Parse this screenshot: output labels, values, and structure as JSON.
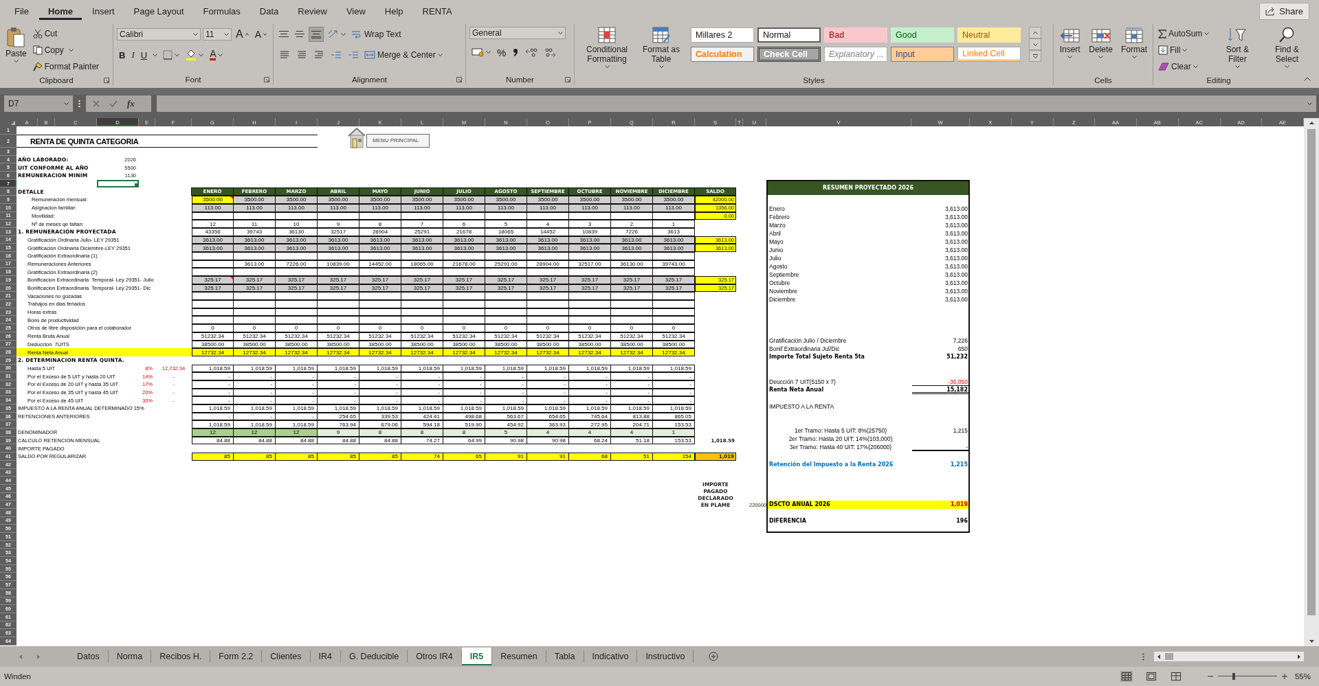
{
  "menu_tabs": [
    {
      "label": "File",
      "selected": false
    },
    {
      "label": "Home",
      "selected": true
    },
    {
      "label": "Insert",
      "selected": false
    },
    {
      "label": "Page Layout",
      "selected": false
    },
    {
      "label": "Formulas",
      "selected": false
    },
    {
      "label": "Data",
      "selected": false
    },
    {
      "label": "Review",
      "selected": false
    },
    {
      "label": "View",
      "selected": false
    },
    {
      "label": "Help",
      "selected": false
    },
    {
      "label": "RENTA",
      "selected": false
    }
  ],
  "share_button": "Share",
  "ribbon": {
    "clipboard": {
      "paste": "Paste",
      "cut": "Cut",
      "copy": "Copy",
      "format_painter": "Format Painter",
      "label": "Clipboard"
    },
    "font": {
      "name": "Calibri",
      "size": "11",
      "grow": "A",
      "shrink": "A",
      "bold": "B",
      "italic": "I",
      "underline": "U",
      "font_color": "A",
      "label": "Font"
    },
    "alignment": {
      "vertical": [
        {
          "selected": false
        },
        {
          "selected": false
        },
        {
          "selected": true
        }
      ],
      "wrap_text": "Wrap Text",
      "merge_center": "Merge & Center",
      "label": "Alignment"
    },
    "number": {
      "format": "General",
      "percent": "%",
      "label": "Number"
    },
    "styles": {
      "conditional_formatting": "Conditional Formatting",
      "format_as_table": "Format as Table",
      "label": "Styles",
      "gallery": [
        {
          "label": "Millares 2",
          "kind": "millares",
          "selected": false
        },
        {
          "label": "Normal",
          "kind": "normal",
          "selected": true
        },
        {
          "label": "Bad",
          "kind": "bad",
          "selected": false
        },
        {
          "label": "Good",
          "kind": "good",
          "selected": false
        },
        {
          "label": "Neutral",
          "kind": "neutral",
          "selected": false
        },
        {
          "label": "Calculation",
          "kind": "calculation",
          "selected": false
        },
        {
          "label": "Check Cell",
          "kind": "check",
          "selected": false
        },
        {
          "label": "Explanatory ...",
          "kind": "explanatory",
          "selected": false
        },
        {
          "label": "Input",
          "kind": "input",
          "selected": false
        },
        {
          "label": "Linked Cell",
          "kind": "linked",
          "selected": false
        }
      ]
    },
    "cells": {
      "buttons": [
        {
          "label": "Insert",
          "kind": "insert"
        },
        {
          "label": "Delete",
          "kind": "delete"
        },
        {
          "label": "Format",
          "kind": "format"
        }
      ],
      "label": "Cells"
    },
    "editing": {
      "autosum": "AutoSum",
      "fill": "Fill",
      "clear": "Clear",
      "sort_filter": "Sort & Filter",
      "find_select": "Find & Select",
      "label": "Editing"
    }
  },
  "formula_bar": {
    "name_box": "D7",
    "fx": "fx"
  },
  "sheet": {
    "column_headers": [
      {
        "label": "A",
        "selected": false
      },
      {
        "label": "B",
        "selected": false
      },
      {
        "label": "C",
        "selected": false
      },
      {
        "label": "D",
        "selected": true
      },
      {
        "label": "E",
        "selected": false
      },
      {
        "label": "F",
        "selected": false
      },
      {
        "label": "G",
        "selected": false
      },
      {
        "label": "H",
        "selected": false
      },
      {
        "label": "I",
        "selected": false
      },
      {
        "label": "J",
        "selected": false
      },
      {
        "label": "K",
        "selected": false
      },
      {
        "label": "L",
        "selected": false
      },
      {
        "label": "M",
        "selected": false
      },
      {
        "label": "N",
        "selected": false
      },
      {
        "label": "O",
        "selected": false
      },
      {
        "label": "P",
        "selected": false
      },
      {
        "label": "Q",
        "selected": false
      },
      {
        "label": "R",
        "selected": false
      },
      {
        "label": "S",
        "selected": false
      },
      {
        "label": "T",
        "selected": false
      },
      {
        "label": "U",
        "selected": false
      },
      {
        "label": "V",
        "selected": false
      },
      {
        "label": "W",
        "selected": false
      },
      {
        "label": "X",
        "selected": false
      },
      {
        "label": "Y",
        "selected": false
      },
      {
        "label": "Z",
        "selected": false
      },
      {
        "label": "AA",
        "selected": false
      },
      {
        "label": "AB",
        "selected": false
      },
      {
        "label": "AC",
        "selected": false
      },
      {
        "label": "AD",
        "selected": false
      },
      {
        "label": "AE",
        "selected": false
      }
    ],
    "row_headers": [
      {
        "label": "1",
        "selected": false
      },
      {
        "label": "2",
        "selected": false
      },
      {
        "label": "3",
        "selected": false
      },
      {
        "label": "4",
        "selected": false
      },
      {
        "label": "5",
        "selected": false
      },
      {
        "label": "6",
        "selected": false
      },
      {
        "label": "7",
        "selected": true
      },
      {
        "label": "8",
        "selected": false
      },
      {
        "label": "9",
        "selected": false
      },
      {
        "label": "10",
        "selected": false
      },
      {
        "label": "11",
        "selected": false
      },
      {
        "label": "12",
        "selected": false
      },
      {
        "label": "13",
        "selected": false
      },
      {
        "label": "14",
        "selected": false
      },
      {
        "label": "15",
        "selected": false
      },
      {
        "label": "16",
        "selected": false
      },
      {
        "label": "17",
        "selected": false
      },
      {
        "label": "18",
        "selected": false
      },
      {
        "label": "19",
        "selected": false
      },
      {
        "label": "20",
        "selected": false
      },
      {
        "label": "21",
        "selected": false
      },
      {
        "label": "22",
        "selected": false
      },
      {
        "label": "23",
        "selected": false
      },
      {
        "label": "24",
        "selected": false
      },
      {
        "label": "25",
        "selected": false
      },
      {
        "label": "26",
        "selected": false
      },
      {
        "label": "27",
        "selected": false
      },
      {
        "label": "28",
        "selected": false
      },
      {
        "label": "29",
        "selected": false
      },
      {
        "label": "30",
        "selected": false
      },
      {
        "label": "31",
        "selected": false
      },
      {
        "label": "32",
        "selected": false
      },
      {
        "label": "33",
        "selected": false
      },
      {
        "label": "34",
        "selected": false
      },
      {
        "label": "35",
        "selected": false
      },
      {
        "label": "36",
        "selected": false
      },
      {
        "label": "37",
        "selected": false
      },
      {
        "label": "38",
        "selected": false
      },
      {
        "label": "39",
        "selected": false
      },
      {
        "label": "40",
        "selected": false
      },
      {
        "label": "41",
        "selected": false
      },
      {
        "label": "42",
        "selected": false
      },
      {
        "label": "43",
        "selected": false
      },
      {
        "label": "44",
        "selected": false
      },
      {
        "label": "45",
        "selected": false
      },
      {
        "label": "46",
        "selected": false
      },
      {
        "label": "47",
        "selected": false
      },
      {
        "label": "48",
        "selected": false
      },
      {
        "label": "49",
        "selected": false
      },
      {
        "label": "50",
        "selected": false
      },
      {
        "label": "51",
        "selected": false
      },
      {
        "label": "52",
        "selected": false
      },
      {
        "label": "53",
        "selected": false
      },
      {
        "label": "54",
        "selected": false
      },
      {
        "label": "55",
        "selected": false
      },
      {
        "label": "56",
        "selected": false
      },
      {
        "label": "57",
        "selected": false
      },
      {
        "label": "58",
        "selected": false
      },
      {
        "label": "59",
        "selected": false
      },
      {
        "label": "60",
        "selected": false
      },
      {
        "label": "61",
        "selected": false
      },
      {
        "label": "62",
        "selected": false
      },
      {
        "label": "63",
        "selected": false
      },
      {
        "label": "64",
        "selected": false
      }
    ],
    "title": "RENTA DE QUINTA CATEGORIA",
    "menu_button": "MENU PRINCIPAL",
    "params": [
      {
        "label": "AÑO LABORADO:",
        "value": "2026"
      },
      {
        "label": "UIT CONFORME AL AÑO",
        "value": "5500"
      },
      {
        "label": "REMUNERACION MINIM",
        "value": "1130"
      }
    ],
    "header_row": {
      "label": "DETALLE",
      "months": [
        "ENERO",
        "FEBRERO",
        "MARZO",
        "ABRIL",
        "MAYO",
        "JUNIO",
        "JULIO",
        "AGOSTO",
        "SEPTIEMBRE",
        "OCTUBRE",
        "NOVIEMBRE",
        "DICIEMBRE"
      ],
      "total": "SALDO"
    },
    "rows": [
      {
        "label": {
          "text": "Remuneración mensual:",
          "kind": "field"
        },
        "cells": {
          "kind": "input",
          "values": [
            {
              "text": "3500.00",
              "color": "#ffff00",
              "comment": true
            },
            "3500.00",
            "3500.00",
            "3500.00",
            "3500.00",
            "3500.00",
            "3500.00",
            "3500.00",
            "3500.00",
            "3500.00",
            "3500.00",
            "3500.00"
          ]
        },
        "total": {
          "text": "42000.00",
          "kind": "saldo"
        }
      },
      {
        "label": {
          "text": "Asignacion familiar:",
          "kind": "field"
        },
        "cells": {
          "kind": "input",
          "values": [
            "113.00",
            "113.00",
            "113.00",
            "113.00",
            "113.00",
            "113.00",
            "113.00",
            "113.00",
            "113.00",
            "113.00",
            "113.00",
            "113.00"
          ]
        },
        "total": {
          "text": "1356.00",
          "kind": "saldo"
        }
      },
      {
        "label": {
          "text": "Movilidad:",
          "kind": "field"
        },
        "cells": {
          "kind": "plain"
        },
        "total": {
          "text": "0.00",
          "kind": "saldo"
        }
      },
      {
        "label": {
          "text": "Nº de meses qe faltan:",
          "kind": "field"
        },
        "cells": {
          "kind": "plain",
          "values": [
            "12",
            "11",
            "10",
            "9",
            "8",
            "7",
            "6",
            "5",
            "4",
            "3",
            "2",
            "1"
          ]
        }
      },
      {
        "label": {
          "text": "1. REMUNERACIÒN PROYECTADA",
          "kind": "heading"
        },
        "cells": {
          "kind": "plain",
          "values": [
            "43356",
            "39743",
            "36130",
            "32517",
            "28904",
            "25291",
            "21678",
            "18065",
            "14452",
            "10839",
            "7226",
            "3613"
          ]
        }
      },
      {
        "label": {
          "text": "Gratificación Ordinaria Julio- LEY 29351",
          "kind": "item"
        },
        "cells": {
          "kind": "input",
          "values": [
            "3613.00",
            "3613.00",
            "3613.00",
            "3613.00",
            "3613.00",
            "3613.00",
            "3613.00",
            "3613.00",
            "3613.00",
            "3613.00",
            "3613.00",
            "3613.00"
          ]
        },
        "total": {
          "text": "3613.00",
          "kind": "saldo"
        }
      },
      {
        "label": {
          "text": "Gratificación Ordinaria Diciembre-LEY 29351",
          "kind": "item"
        },
        "cells": {
          "kind": "input",
          "values": [
            "3613.00",
            "3613.00",
            "3613.00",
            "3613.00",
            "3613.00",
            "3613.00",
            "3613.00",
            "3613.00",
            "3613.00",
            "3613.00",
            "3613.00",
            "3613.00"
          ]
        },
        "total": {
          "text": "3613.00",
          "kind": "saldo"
        }
      },
      {
        "label": {
          "text": "Gratificación Extraordinaria (1)",
          "kind": "item"
        },
        "cells": {
          "kind": "plain"
        }
      },
      {
        "label": {
          "text": "Remuneraciones Anteriores",
          "kind": "item"
        },
        "cells": {
          "kind": "plain",
          "lead_blank": true,
          "values": [
            "3613.00",
            "7226.00",
            "10839.00",
            "14452.00",
            "18065.00",
            "21678.00",
            "25291.00",
            "28904.00",
            "32517.00",
            "36130.00",
            "39743.00"
          ]
        }
      },
      {
        "label": {
          "text": "Gratificación Extraordinaria (2)",
          "kind": "item"
        },
        "cells": {
          "kind": "plain"
        }
      },
      {
        "label": {
          "text": "Bonificacion Extraordinaria  Temporal- Ley 29351- Julio",
          "kind": "item"
        },
        "cells": {
          "kind": "input",
          "values": [
            {
              "text": "325.17",
              "comment": true
            },
            "325.17",
            "325.17",
            "325.17",
            "325.17",
            "325.17",
            "325.17",
            "325.17",
            "325.17",
            "325.17",
            "325.17",
            "325.17"
          ]
        },
        "total": {
          "text": "325.17",
          "kind": "saldo"
        }
      },
      {
        "label": {
          "text": "Bonificacion Extraordinaria  Temporal- Ley 29351- Dic",
          "kind": "item"
        },
        "cells": {
          "kind": "input",
          "values": [
            "325.17",
            "325.17",
            "325.17",
            "325.17",
            "325.17",
            "325.17",
            "325.17",
            "325.17",
            "325.17",
            "325.17",
            "325.17",
            "325.17"
          ]
        },
        "total": {
          "text": "325.17",
          "kind": "saldo"
        }
      },
      {
        "label": {
          "text": "Vacaciones no gozadas",
          "kind": "item"
        },
        "cells": {
          "kind": "plain"
        }
      },
      {
        "label": {
          "text": "Trabajos en dias feriados",
          "kind": "item"
        },
        "cells": {
          "kind": "plain"
        }
      },
      {
        "label": {
          "text": "Horas extras",
          "kind": "item"
        },
        "cells": {
          "kind": "plain"
        }
      },
      {
        "label": {
          "text": "Bono de productividad",
          "kind": "item"
        },
        "cells": {
          "kind": "plain"
        }
      },
      {
        "label": {
          "text": "Otros de libre disposición para el colaborador",
          "kind": "item"
        },
        "cells": {
          "kind": "plain",
          "values": [
            "0",
            "0",
            "0",
            "0",
            "0",
            "0",
            "0",
            "0",
            "0",
            "0",
            "0",
            "0"
          ]
        }
      },
      {
        "label": {
          "text": "Renta Bruta Anual",
          "kind": "item"
        },
        "cells": {
          "kind": "plain",
          "values": [
            "51232.34",
            "51232.34",
            "51232.34",
            "51232.34",
            "51232.34",
            "51232.34",
            "51232.34",
            "51232.34",
            "51232.34",
            "51232.34",
            "51232.34",
            "51232.34"
          ]
        }
      },
      {
        "label": {
          "text": "Deduccion  7UITS",
          "kind": "item"
        },
        "cells": {
          "kind": "plain",
          "values": [
            "38500.00",
            "38500.00",
            "38500.00",
            "38500.00",
            "38500.00",
            "38500.00",
            "38500.00",
            "38500.00",
            "38500.00",
            "38500.00",
            "38500.00",
            "38500.00"
          ]
        }
      },
      {
        "label": {
          "text": "Renta Neta Anual",
          "kind": "marked"
        },
        "cells": {
          "kind": "highlight",
          "values": [
            "12732.34",
            "12732.34",
            "12732.34",
            "12732.34",
            "12732.34",
            "12732.34",
            "12732.34",
            "12732.34",
            "12732.34",
            "12732.34",
            "12732.34",
            "12732.34"
          ]
        }
      },
      {
        "label": {
          "text": "2. DETERMINACION RENTA QUINTA.",
          "kind": "heading"
        }
      },
      {
        "label": {
          "text": "Hasta 5 UIT",
          "kind": "item"
        },
        "rate": "8%",
        "amount": "12,732.34",
        "cells": {
          "kind": "amount",
          "values": [
            "1,018.59",
            "1,018.59",
            "1,018.59",
            "1,018.59",
            "1,018.59",
            "1,018.59",
            "1,018.59",
            "1,018.59",
            "1,018.59",
            "1,018.59",
            "1,018.59",
            "1,018.59"
          ]
        }
      },
      {
        "label": {
          "text": "Por el Exceso de 5 UIT y hasta 20 UIT",
          "kind": "item"
        },
        "rate": "14%",
        "amount": "-",
        "cells": {
          "kind": "amount",
          "values": [
            "-",
            "-",
            "-",
            "-",
            "-",
            "-",
            "-",
            "-",
            "-",
            "-",
            "-",
            "-"
          ]
        }
      },
      {
        "label": {
          "text": "Por el Exceso de 20 UIT y hasta 35 UIT",
          "kind": "item"
        },
        "rate": "17%",
        "amount": "-",
        "cells": {
          "kind": "amount",
          "values": [
            "-",
            "-",
            "-",
            "-",
            "-",
            "-",
            "-",
            "-",
            "-",
            "-",
            "-",
            "-"
          ]
        }
      },
      {
        "label": {
          "text": "Por el Exceso de 35 UIT y hasta 45 UIT",
          "kind": "item"
        },
        "rate": "20%",
        "amount": "-",
        "cells": {
          "kind": "amount",
          "values": [
            "-",
            "-",
            "-",
            "-",
            "-",
            "-",
            "-",
            "-",
            "-",
            "-",
            "-",
            "-"
          ]
        }
      },
      {
        "label": {
          "text": "Por el Exceso de 45 UIT",
          "kind": "item"
        },
        "rate": "30%",
        "amount": "-",
        "cells": {
          "kind": "amount",
          "values": [
            "-",
            "-",
            "-",
            "-",
            "-",
            "-",
            "-",
            "-",
            "-",
            "-",
            "-",
            "-"
          ]
        }
      },
      {
        "label": {
          "text": "IMPUESTO A LA RENTA ANUAL DETERMINADO 15%",
          "kind": "caps"
        },
        "cells": {
          "kind": "amount",
          "values": [
            "1,018.59",
            "1,018.59",
            "1,018.59",
            "1,018.59",
            "1,018.59",
            "1,018.59",
            "1,018.59",
            "1,018.59",
            "1,018.59",
            "1,018.59",
            "1,018.59",
            "1,018.59"
          ]
        }
      },
      {
        "label": {
          "text": "RETENCIONES ANTERIORES",
          "kind": "caps"
        },
        "cells": {
          "kind": "amount",
          "values": [
            "-",
            "-",
            "-",
            "254.65",
            "339.53",
            "424.41",
            "498.68",
            "563.67",
            "654.65",
            "745.64",
            "813.88",
            "865.05"
          ]
        }
      },
      {
        "cells": {
          "kind": "amount",
          "values": [
            "1,018.59",
            "1,018.59",
            "1,018.59",
            "763.94",
            "679.06",
            "594.18",
            "519.90",
            "454.92",
            "363.93",
            "272.95",
            "204.71",
            "153.53"
          ]
        }
      },
      {
        "label": {
          "text": "DENOMINADOR",
          "kind": "caps"
        },
        "cells": {
          "kind": "denominator",
          "values": [
            {
              "text": "12",
              "color": "#a9d08e"
            },
            {
              "text": "12",
              "color": "#a9d08e"
            },
            {
              "text": "12",
              "color": "#a9d08e"
            },
            "9",
            "8",
            "8",
            "8",
            "5",
            "4",
            "4",
            "4",
            "1"
          ]
        }
      },
      {
        "label": {
          "text": "CALCULO RETENCION MENSUAL",
          "kind": "caps"
        },
        "cells": {
          "kind": "amount",
          "values": [
            "84.88",
            "84.88",
            "84.88",
            "84.88",
            "84.88",
            "74.27",
            "64.99",
            "90.98",
            "90.98",
            "68.24",
            "51.18",
            "153.53"
          ]
        },
        "total": {
          "text": "1,018.59",
          "kind": "sum"
        }
      },
      {
        "label": {
          "text": "IMPORTE PAGADO",
          "kind": "caps"
        }
      },
      {
        "label": {
          "text": "SALDO POR REGULARIZAR",
          "kind": "caps"
        },
        "cells": {
          "kind": "balance",
          "values": [
            "85",
            "85",
            "85",
            "85",
            "85",
            "74",
            "65",
            "91",
            "91",
            "68",
            "51",
            "154"
          ]
        },
        "total": {
          "text": "1,019",
          "kind": "final"
        }
      }
    ],
    "plame": {
      "label": "IMPORTE PAGADO DECLARADO EN PLAME",
      "value": "220000"
    }
  },
  "summary": {
    "title": "RESUMEN PROYECTADO 2026",
    "sections": [
      {
        "kind": "months",
        "lines": [
          {
            "label": "Enero",
            "value": "3,613.00",
            "kind": "plain"
          },
          {
            "label": "Febrero",
            "value": "3,613.00",
            "kind": "plain"
          },
          {
            "label": "Marzo",
            "value": "3,613.00",
            "kind": "plain"
          },
          {
            "label": "Abril",
            "value": "3,613.00",
            "kind": "plain"
          },
          {
            "label": "Mayo",
            "value": "3,613.00",
            "kind": "plain"
          },
          {
            "label": "Junio",
            "value": "3,613.00",
            "kind": "plain"
          },
          {
            "label": "Julio",
            "value": "3,613.00",
            "kind": "plain"
          },
          {
            "label": "Agosto",
            "value": "3,613.00",
            "kind": "plain"
          },
          {
            "label": "Septiembre",
            "value": "3,613.00",
            "kind": "plain"
          },
          {
            "label": "Octubre",
            "value": "3,613.00",
            "kind": "plain"
          },
          {
            "label": "Noviembre",
            "value": "3,613.00",
            "kind": "plain"
          },
          {
            "label": "Diciembre",
            "value": "3,613.00",
            "kind": "plain"
          }
        ]
      },
      {
        "kind": "extras",
        "lines": [
          {
            "label": "Gratificación Julio / Diciembre",
            "value": "7,226",
            "kind": "plain"
          },
          {
            "label": "Bonif Extraordinaria Jul/Dic",
            "value": "650",
            "kind": "plain"
          },
          {
            "label": "Importe Total Sujeto Renta 5ta",
            "value": "51,232",
            "kind": "total"
          }
        ]
      },
      {
        "kind": "net",
        "lines": [
          {
            "label": "Deucción 7 UIT(5150 x 7)",
            "value": "-36,050",
            "kind": "negative"
          },
          {
            "label": "Renta Neta Anual",
            "value": "15,182",
            "kind": "net"
          }
        ]
      },
      {
        "kind": "tax",
        "lines": [
          {
            "label": "IMPUESTO A LA RENTA",
            "kind": "plain"
          }
        ]
      },
      {
        "kind": "brackets",
        "lines": [
          {
            "label": "1er Tramo: Hasta 5 UIT: 8%(25750)",
            "value": "1,215",
            "kind": "bracket"
          },
          {
            "label": "2er Tramo: Hasta 20 UIT: 14%(103,000)",
            "kind": "bracket"
          },
          {
            "label": "3er Tramo: Hasta 40 UIT: 17%(206000)",
            "value": "-",
            "kind": "bracket_end"
          }
        ]
      },
      {
        "kind": "retention",
        "lines": [
          {
            "label": "Retención del Impuesto a la Renta 2026",
            "value": "1,215",
            "kind": "retention"
          }
        ]
      },
      {
        "kind": "discount",
        "lines": [
          {
            "label": "DSCTO ANUAL 2026",
            "value": "1,019",
            "kind": "discount"
          }
        ]
      },
      {
        "kind": "difference",
        "lines": [
          {
            "label": "DIFERENCIA",
            "value": "196",
            "kind": "result"
          }
        ]
      }
    ]
  },
  "sheet_tabs": [
    {
      "label": "Datos",
      "selected": false
    },
    {
      "label": "Norma",
      "selected": false
    },
    {
      "label": "Recibos H.",
      "selected": false
    },
    {
      "label": "Form 2.2",
      "selected": false
    },
    {
      "label": "Clientes",
      "selected": false
    },
    {
      "label": "IR4",
      "selected": false
    },
    {
      "label": "G. Deducible",
      "selected": false
    },
    {
      "label": "Otros IR4",
      "selected": false
    },
    {
      "label": "IR5",
      "selected": true
    },
    {
      "label": "Resumen",
      "selected": false
    },
    {
      "label": "Tabla",
      "selected": false
    },
    {
      "label": "Indicativo",
      "selected": false
    },
    {
      "label": "Instructivo",
      "selected": false
    }
  ],
  "status_bar": {
    "text": "Winden",
    "zoom": {
      "level": 0.27,
      "reading": "55%"
    }
  }
}
